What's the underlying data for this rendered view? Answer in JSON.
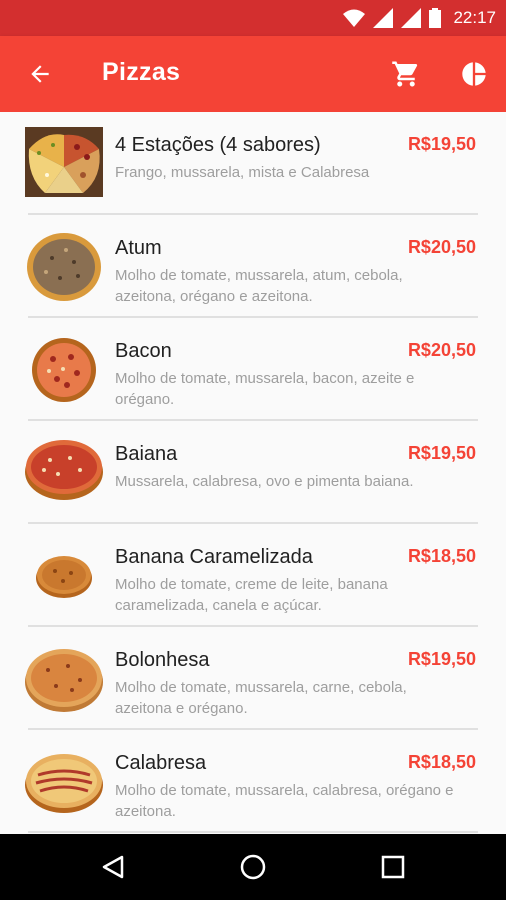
{
  "status_bar": {
    "time": "22:17"
  },
  "app_bar": {
    "title": "Pizzas",
    "back_icon": "arrow-back-icon",
    "cart_icon": "cart-icon",
    "chart_icon": "pie-chart-icon",
    "color": "#f44336",
    "status_color": "#d32f2f"
  },
  "pizzas": [
    {
      "name": "4 Estações (4 sabores)",
      "price": "R$19,50",
      "desc": "Frango, mussarela, mista e Calabresa"
    },
    {
      "name": "Atum",
      "price": "R$20,50",
      "desc": "Molho de tomate, mussarela, atum, cebola, azeitona, orégano e azeitona."
    },
    {
      "name": "Bacon",
      "price": "R$20,50",
      "desc": "Molho de tomate, mussarela, bacon, azeite e orégano."
    },
    {
      "name": "Baiana",
      "price": "R$19,50",
      "desc": "Mussarela, calabresa, ovo e pimenta baiana."
    },
    {
      "name": "Banana Caramelizada",
      "price": "R$18,50",
      "desc": "Molho de tomate, creme de leite, banana caramelizada, canela e açúcar."
    },
    {
      "name": "Bolonhesa",
      "price": "R$19,50",
      "desc": "Molho de tomate, mussarela, carne, cebola, azeitona e orégano."
    },
    {
      "name": "Calabresa",
      "price": "R$18,50",
      "desc": "Molho de tomate, mussarela, calabresa, orégano e azeitona."
    }
  ],
  "nav_bar": {
    "back_icon": "nav-back-icon",
    "home_icon": "nav-home-icon",
    "recents_icon": "nav-recents-icon"
  }
}
